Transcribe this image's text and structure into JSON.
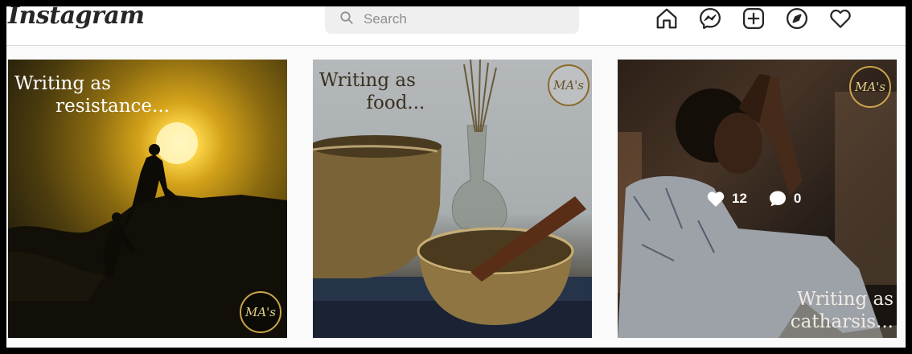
{
  "app": {
    "logo": "Instagram"
  },
  "search": {
    "placeholder": "Search"
  },
  "nav": {
    "icons": [
      "home-icon",
      "messenger-icon",
      "new-post-icon",
      "explore-icon",
      "activity-heart-icon"
    ]
  },
  "posts": [
    {
      "caption": "Writing as\n       resistance...",
      "watermark": "MA's"
    },
    {
      "caption": "Writing as\n        food...",
      "watermark": "MA's"
    },
    {
      "caption": "Writing as\n   catharsis...",
      "watermark": "MA's",
      "likes": "12",
      "comments": "0"
    }
  ],
  "colors": {
    "background": "#fafafa",
    "topbar": "#ffffff",
    "search_bg": "#efefef",
    "icon": "#262626"
  }
}
